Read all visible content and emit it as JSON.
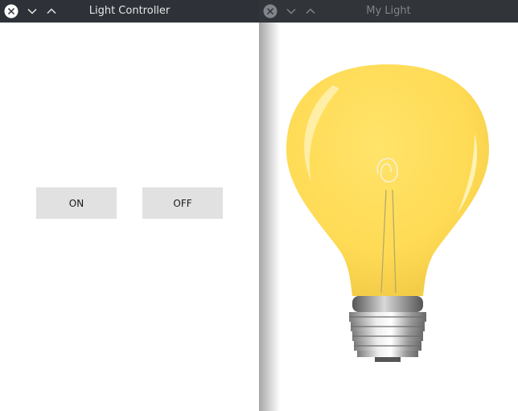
{
  "windows": [
    {
      "id": "controller",
      "title": "Light Controller",
      "buttons": {
        "on_label": "ON",
        "off_label": "OFF"
      }
    },
    {
      "id": "light",
      "title": "My Light",
      "image": {
        "icon": "lightbulb",
        "state": "on",
        "glass_color": "#ffde5a"
      }
    }
  ],
  "titlebar_icons": [
    "close-icon",
    "minimize-icon",
    "maximize-icon"
  ],
  "colors": {
    "titlebar_bg": "#2e3238",
    "button_bg": "#e1e1e1",
    "bulb_yellow": "#ffde5a"
  }
}
